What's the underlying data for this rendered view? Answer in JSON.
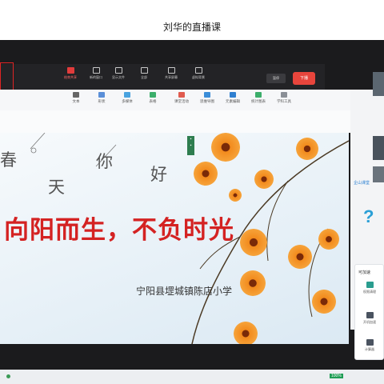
{
  "page": {
    "title": "刘华的直播课"
  },
  "meeting_toolbar": {
    "items": [
      {
        "label": "结束共享",
        "icon": "stop-share-icon"
      },
      {
        "label": "新的窗口",
        "icon": "window-icon"
      },
      {
        "label": "显示文件",
        "icon": "file-icon"
      },
      {
        "label": "全部",
        "icon": "members-icon"
      },
      {
        "label": "共享屏幕",
        "icon": "share-screen-icon"
      },
      {
        "label": "虚拟背景",
        "icon": "sparkle-icon"
      }
    ],
    "pause_label": "暂停",
    "end_label": "下播",
    "accent_color": "#e8453c"
  },
  "ribbon": {
    "items": [
      {
        "label": "文本",
        "icon": "text-icon"
      },
      {
        "label": "形状",
        "icon": "shape-icon"
      },
      {
        "label": "多媒体",
        "icon": "media-icon"
      },
      {
        "label": "表格",
        "icon": "table-icon"
      },
      {
        "label": "课堂活动",
        "icon": "activity-icon"
      },
      {
        "label": "思维导图",
        "icon": "mindmap-icon"
      },
      {
        "label": "元素编辑",
        "icon": "edit-icon"
      },
      {
        "label": "统计图表",
        "icon": "chart-icon"
      },
      {
        "label": "学科工具",
        "icon": "subject-tools-icon"
      }
    ]
  },
  "slide": {
    "words": [
      "春",
      "天",
      "你",
      "好"
    ],
    "slogan": "向阳而生，不负时光",
    "school": "宁阳县堽城镇陈店小学"
  },
  "side_panel": {
    "header": "企山课堂",
    "question_mark": "?",
    "card_title": "可加速",
    "items": [
      {
        "label": "权限清理",
        "icon": "cleanup-icon"
      },
      {
        "label": "开机加速",
        "icon": "boot-speed-icon"
      },
      {
        "label": "计算器",
        "icon": "calculator-icon"
      }
    ]
  },
  "status": {
    "zoom": "100%"
  }
}
